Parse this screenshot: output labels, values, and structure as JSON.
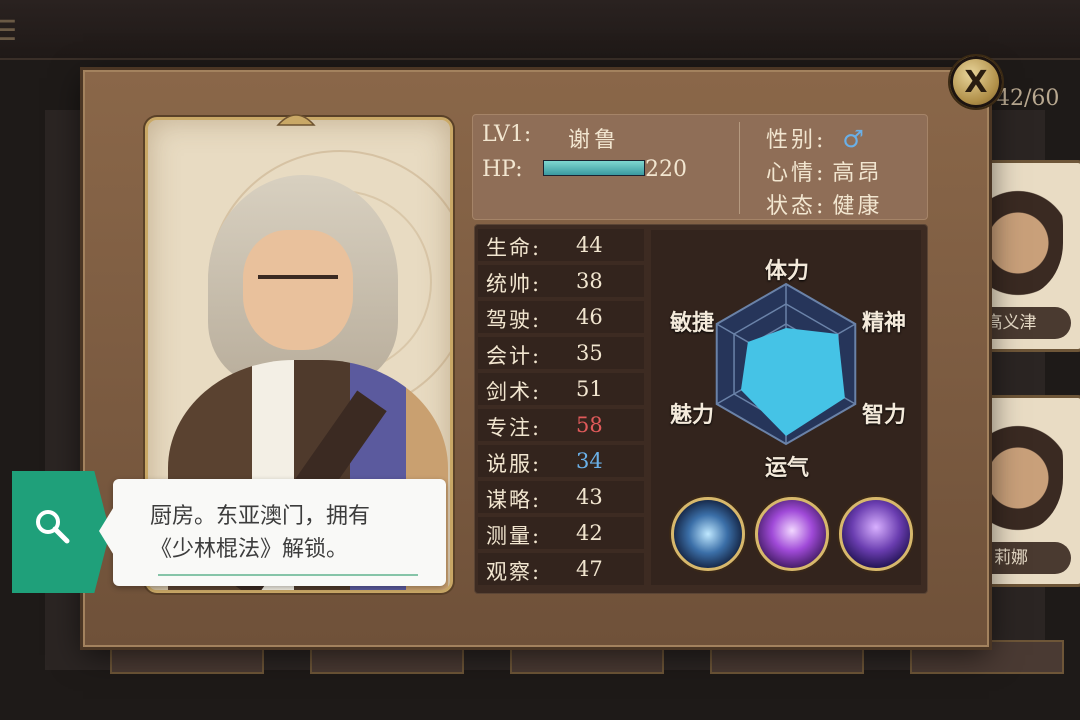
{
  "background": {
    "count_text": "42/60",
    "cards": [
      {
        "name": "高义津"
      },
      {
        "name": "莉娜"
      }
    ]
  },
  "character": {
    "level_label": "LV1:",
    "name": "谢鲁",
    "hp_label": "HP:",
    "hp_value": "220",
    "hp_fill_fraction": 1.0,
    "gender_label": "性别:",
    "gender_icon": "male-symbol-icon",
    "gender_glyph": "♂",
    "mood_label": "心情:",
    "mood_value": "高昂",
    "status_label": "状态:",
    "status_value": "健康"
  },
  "stats": [
    {
      "label": "生命:",
      "value": "44",
      "color": "#f2e6d0"
    },
    {
      "label": "统帅:",
      "value": "38",
      "color": "#f2e6d0"
    },
    {
      "label": "驾驶:",
      "value": "46",
      "color": "#f2e6d0"
    },
    {
      "label": "会计:",
      "value": "35",
      "color": "#f2e6d0"
    },
    {
      "label": "剑术:",
      "value": "51",
      "color": "#f2e6d0"
    },
    {
      "label": "专注:",
      "value": "58",
      "color": "#e05a5a"
    },
    {
      "label": "说服:",
      "value": "34",
      "color": "#6ab0e8"
    },
    {
      "label": "谋略:",
      "value": "43",
      "color": "#f2e6d0"
    },
    {
      "label": "测量:",
      "value": "42",
      "color": "#f2e6d0"
    },
    {
      "label": "观察:",
      "value": "47",
      "color": "#f2e6d0"
    }
  ],
  "radar": {
    "axes": [
      "体力",
      "精神",
      "智力",
      "运气",
      "魅力",
      "敏捷"
    ],
    "values": [
      0.45,
      0.75,
      0.85,
      0.9,
      0.65,
      0.55
    ],
    "fill_color": "#45c3e6",
    "grid_color": "#6a82a8",
    "bg_color": "#26355a"
  },
  "skills": [
    {
      "icon": "lightning-slash-skill-icon"
    },
    {
      "icon": "fist-energy-skill-icon"
    },
    {
      "icon": "third-eye-meditation-skill-icon"
    }
  ],
  "tooltip": {
    "icon": "search-icon",
    "accent_color": "#1fa07a",
    "line1": "厨房。东亚澳门，拥有",
    "line2": "《少林棍法》解锁。"
  },
  "close_button": {
    "label": "X"
  }
}
